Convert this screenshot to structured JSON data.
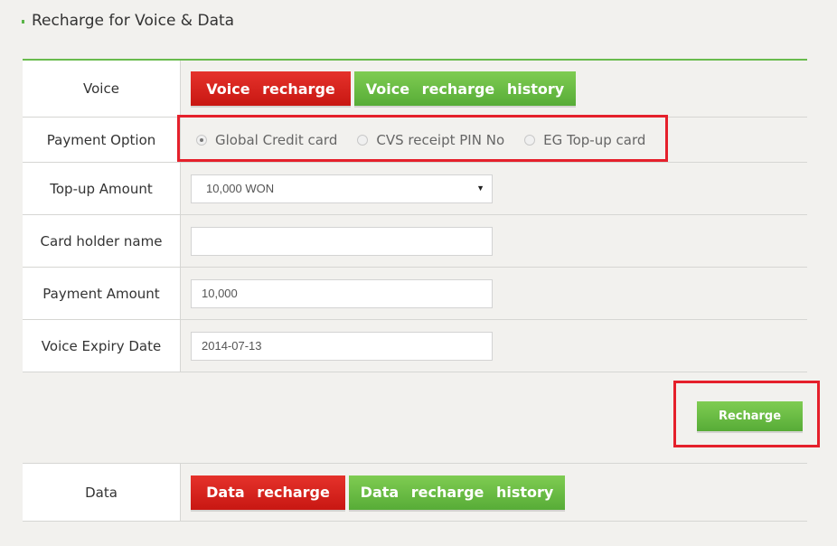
{
  "page": {
    "title": "Recharge for Voice & Data"
  },
  "voice_row": {
    "label": "Voice",
    "recharge_button": "Voice recharge",
    "history_button": "Voice recharge history"
  },
  "payment_option": {
    "label": "Payment Option",
    "options": [
      {
        "label": "Global Credit card",
        "checked": true
      },
      {
        "label": "CVS receipt PIN No",
        "checked": false
      },
      {
        "label": "EG Top-up card",
        "checked": false
      }
    ]
  },
  "topup_amount": {
    "label": "Top-up Amount",
    "selected": "10,000 WON"
  },
  "card_holder": {
    "label": "Card holder name",
    "value": ""
  },
  "payment_amount": {
    "label": "Payment Amount",
    "value": "10,000"
  },
  "expiry": {
    "label": "Voice Expiry Date",
    "value": "2014-07-13"
  },
  "recharge_button": "Recharge",
  "data_row": {
    "label": "Data",
    "recharge_button": "Data recharge",
    "history_button": "Data recharge history"
  },
  "colors": {
    "accent_green": "#5ab548",
    "button_red": "#d42219",
    "highlight_red": "#e5202b"
  }
}
